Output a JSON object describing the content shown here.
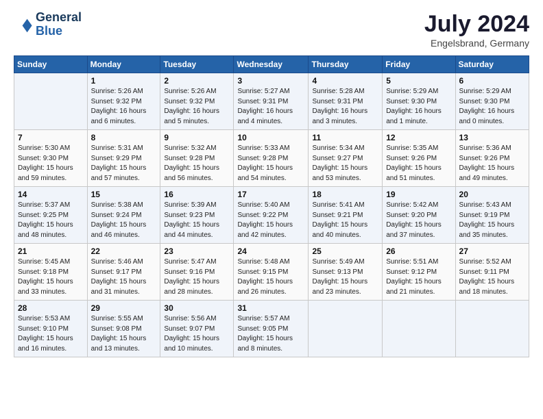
{
  "header": {
    "logo_line1": "General",
    "logo_line2": "Blue",
    "month_year": "July 2024",
    "location": "Engelsbrand, Germany"
  },
  "days_of_week": [
    "Sunday",
    "Monday",
    "Tuesday",
    "Wednesday",
    "Thursday",
    "Friday",
    "Saturday"
  ],
  "weeks": [
    [
      {
        "day": "",
        "empty": true
      },
      {
        "day": "1",
        "sunrise": "5:26 AM",
        "sunset": "9:32 PM",
        "daylight": "16 hours and 6 minutes."
      },
      {
        "day": "2",
        "sunrise": "5:26 AM",
        "sunset": "9:32 PM",
        "daylight": "16 hours and 5 minutes."
      },
      {
        "day": "3",
        "sunrise": "5:27 AM",
        "sunset": "9:31 PM",
        "daylight": "16 hours and 4 minutes."
      },
      {
        "day": "4",
        "sunrise": "5:28 AM",
        "sunset": "9:31 PM",
        "daylight": "16 hours and 3 minutes."
      },
      {
        "day": "5",
        "sunrise": "5:29 AM",
        "sunset": "9:30 PM",
        "daylight": "16 hours and 1 minute."
      },
      {
        "day": "6",
        "sunrise": "5:29 AM",
        "sunset": "9:30 PM",
        "daylight": "16 hours and 0 minutes."
      }
    ],
    [
      {
        "day": "7",
        "sunrise": "5:30 AM",
        "sunset": "9:30 PM",
        "daylight": "15 hours and 59 minutes."
      },
      {
        "day": "8",
        "sunrise": "5:31 AM",
        "sunset": "9:29 PM",
        "daylight": "15 hours and 57 minutes."
      },
      {
        "day": "9",
        "sunrise": "5:32 AM",
        "sunset": "9:28 PM",
        "daylight": "15 hours and 56 minutes."
      },
      {
        "day": "10",
        "sunrise": "5:33 AM",
        "sunset": "9:28 PM",
        "daylight": "15 hours and 54 minutes."
      },
      {
        "day": "11",
        "sunrise": "5:34 AM",
        "sunset": "9:27 PM",
        "daylight": "15 hours and 53 minutes."
      },
      {
        "day": "12",
        "sunrise": "5:35 AM",
        "sunset": "9:26 PM",
        "daylight": "15 hours and 51 minutes."
      },
      {
        "day": "13",
        "sunrise": "5:36 AM",
        "sunset": "9:26 PM",
        "daylight": "15 hours and 49 minutes."
      }
    ],
    [
      {
        "day": "14",
        "sunrise": "5:37 AM",
        "sunset": "9:25 PM",
        "daylight": "15 hours and 48 minutes."
      },
      {
        "day": "15",
        "sunrise": "5:38 AM",
        "sunset": "9:24 PM",
        "daylight": "15 hours and 46 minutes."
      },
      {
        "day": "16",
        "sunrise": "5:39 AM",
        "sunset": "9:23 PM",
        "daylight": "15 hours and 44 minutes."
      },
      {
        "day": "17",
        "sunrise": "5:40 AM",
        "sunset": "9:22 PM",
        "daylight": "15 hours and 42 minutes."
      },
      {
        "day": "18",
        "sunrise": "5:41 AM",
        "sunset": "9:21 PM",
        "daylight": "15 hours and 40 minutes."
      },
      {
        "day": "19",
        "sunrise": "5:42 AM",
        "sunset": "9:20 PM",
        "daylight": "15 hours and 37 minutes."
      },
      {
        "day": "20",
        "sunrise": "5:43 AM",
        "sunset": "9:19 PM",
        "daylight": "15 hours and 35 minutes."
      }
    ],
    [
      {
        "day": "21",
        "sunrise": "5:45 AM",
        "sunset": "9:18 PM",
        "daylight": "15 hours and 33 minutes."
      },
      {
        "day": "22",
        "sunrise": "5:46 AM",
        "sunset": "9:17 PM",
        "daylight": "15 hours and 31 minutes."
      },
      {
        "day": "23",
        "sunrise": "5:47 AM",
        "sunset": "9:16 PM",
        "daylight": "15 hours and 28 minutes."
      },
      {
        "day": "24",
        "sunrise": "5:48 AM",
        "sunset": "9:15 PM",
        "daylight": "15 hours and 26 minutes."
      },
      {
        "day": "25",
        "sunrise": "5:49 AM",
        "sunset": "9:13 PM",
        "daylight": "15 hours and 23 minutes."
      },
      {
        "day": "26",
        "sunrise": "5:51 AM",
        "sunset": "9:12 PM",
        "daylight": "15 hours and 21 minutes."
      },
      {
        "day": "27",
        "sunrise": "5:52 AM",
        "sunset": "9:11 PM",
        "daylight": "15 hours and 18 minutes."
      }
    ],
    [
      {
        "day": "28",
        "sunrise": "5:53 AM",
        "sunset": "9:10 PM",
        "daylight": "15 hours and 16 minutes."
      },
      {
        "day": "29",
        "sunrise": "5:55 AM",
        "sunset": "9:08 PM",
        "daylight": "15 hours and 13 minutes."
      },
      {
        "day": "30",
        "sunrise": "5:56 AM",
        "sunset": "9:07 PM",
        "daylight": "15 hours and 10 minutes."
      },
      {
        "day": "31",
        "sunrise": "5:57 AM",
        "sunset": "9:05 PM",
        "daylight": "15 hours and 8 minutes."
      },
      {
        "day": "",
        "empty": true
      },
      {
        "day": "",
        "empty": true
      },
      {
        "day": "",
        "empty": true
      }
    ]
  ]
}
